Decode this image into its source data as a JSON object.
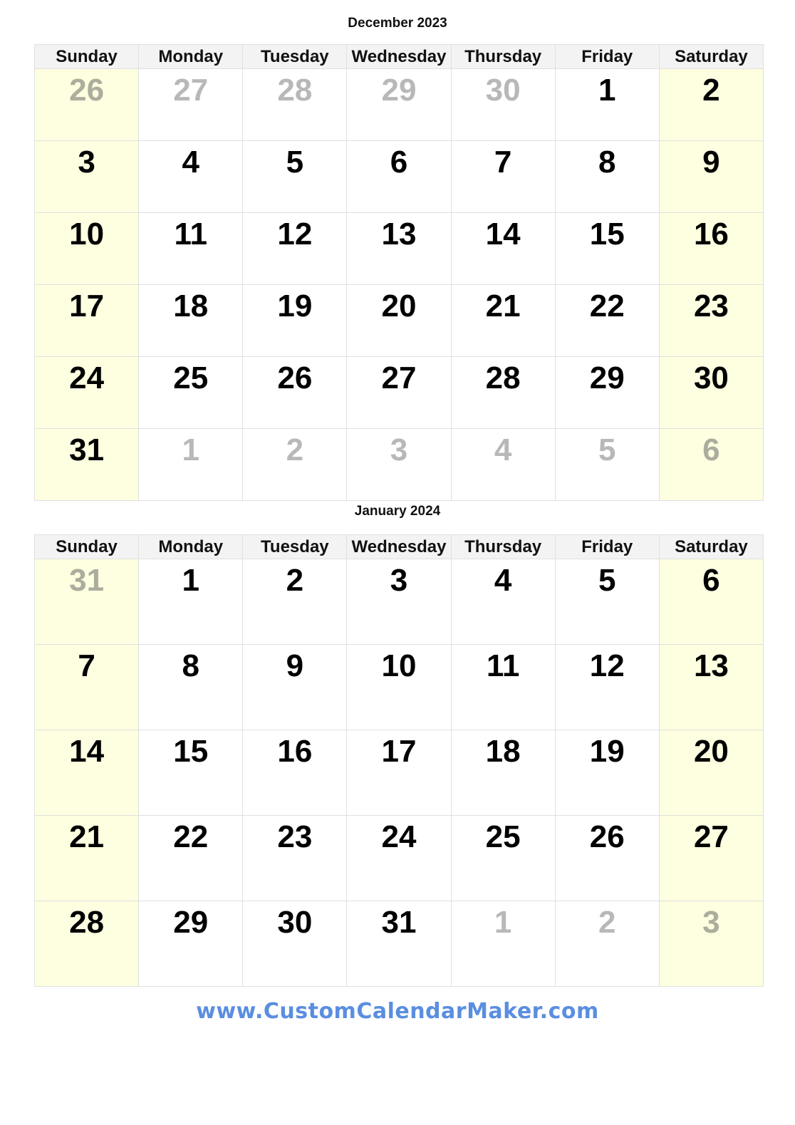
{
  "weekdays": [
    "Sunday",
    "Monday",
    "Tuesday",
    "Wednesday",
    "Thursday",
    "Friday",
    "Saturday"
  ],
  "months": [
    {
      "title": "December 2023",
      "weeks": [
        [
          {
            "d": "26",
            "o": true
          },
          {
            "d": "27",
            "o": true
          },
          {
            "d": "28",
            "o": true
          },
          {
            "d": "29",
            "o": true
          },
          {
            "d": "30",
            "o": true
          },
          {
            "d": "1",
            "o": false
          },
          {
            "d": "2",
            "o": false
          }
        ],
        [
          {
            "d": "3",
            "o": false
          },
          {
            "d": "4",
            "o": false
          },
          {
            "d": "5",
            "o": false
          },
          {
            "d": "6",
            "o": false
          },
          {
            "d": "7",
            "o": false
          },
          {
            "d": "8",
            "o": false
          },
          {
            "d": "9",
            "o": false
          }
        ],
        [
          {
            "d": "10",
            "o": false
          },
          {
            "d": "11",
            "o": false
          },
          {
            "d": "12",
            "o": false
          },
          {
            "d": "13",
            "o": false
          },
          {
            "d": "14",
            "o": false
          },
          {
            "d": "15",
            "o": false
          },
          {
            "d": "16",
            "o": false
          }
        ],
        [
          {
            "d": "17",
            "o": false
          },
          {
            "d": "18",
            "o": false
          },
          {
            "d": "19",
            "o": false
          },
          {
            "d": "20",
            "o": false
          },
          {
            "d": "21",
            "o": false
          },
          {
            "d": "22",
            "o": false
          },
          {
            "d": "23",
            "o": false
          }
        ],
        [
          {
            "d": "24",
            "o": false
          },
          {
            "d": "25",
            "o": false
          },
          {
            "d": "26",
            "o": false
          },
          {
            "d": "27",
            "o": false
          },
          {
            "d": "28",
            "o": false
          },
          {
            "d": "29",
            "o": false
          },
          {
            "d": "30",
            "o": false
          }
        ],
        [
          {
            "d": "31",
            "o": false
          },
          {
            "d": "1",
            "o": true
          },
          {
            "d": "2",
            "o": true
          },
          {
            "d": "3",
            "o": true
          },
          {
            "d": "4",
            "o": true
          },
          {
            "d": "5",
            "o": true
          },
          {
            "d": "6",
            "o": true
          }
        ]
      ]
    },
    {
      "title": "January 2024",
      "weeks": [
        [
          {
            "d": "31",
            "o": true
          },
          {
            "d": "1",
            "o": false
          },
          {
            "d": "2",
            "o": false
          },
          {
            "d": "3",
            "o": false
          },
          {
            "d": "4",
            "o": false
          },
          {
            "d": "5",
            "o": false
          },
          {
            "d": "6",
            "o": false
          }
        ],
        [
          {
            "d": "7",
            "o": false
          },
          {
            "d": "8",
            "o": false
          },
          {
            "d": "9",
            "o": false
          },
          {
            "d": "10",
            "o": false
          },
          {
            "d": "11",
            "o": false
          },
          {
            "d": "12",
            "o": false
          },
          {
            "d": "13",
            "o": false
          }
        ],
        [
          {
            "d": "14",
            "o": false
          },
          {
            "d": "15",
            "o": false
          },
          {
            "d": "16",
            "o": false
          },
          {
            "d": "17",
            "o": false
          },
          {
            "d": "18",
            "o": false
          },
          {
            "d": "19",
            "o": false
          },
          {
            "d": "20",
            "o": false
          }
        ],
        [
          {
            "d": "21",
            "o": false
          },
          {
            "d": "22",
            "o": false
          },
          {
            "d": "23",
            "o": false
          },
          {
            "d": "24",
            "o": false
          },
          {
            "d": "25",
            "o": false
          },
          {
            "d": "26",
            "o": false
          },
          {
            "d": "27",
            "o": false
          }
        ],
        [
          {
            "d": "28",
            "o": false
          },
          {
            "d": "29",
            "o": false
          },
          {
            "d": "30",
            "o": false
          },
          {
            "d": "31",
            "o": false
          },
          {
            "d": "1",
            "o": true
          },
          {
            "d": "2",
            "o": true
          },
          {
            "d": "3",
            "o": true
          }
        ]
      ]
    }
  ],
  "colors": {
    "weekend_bg": "#fefee0",
    "header_bg": "#f3f3f3",
    "other_month_text": "#b8b8b8",
    "footer_text": "#5a8ee0"
  },
  "footer": {
    "url_text": "www.CustomCalendarMaker.com"
  }
}
